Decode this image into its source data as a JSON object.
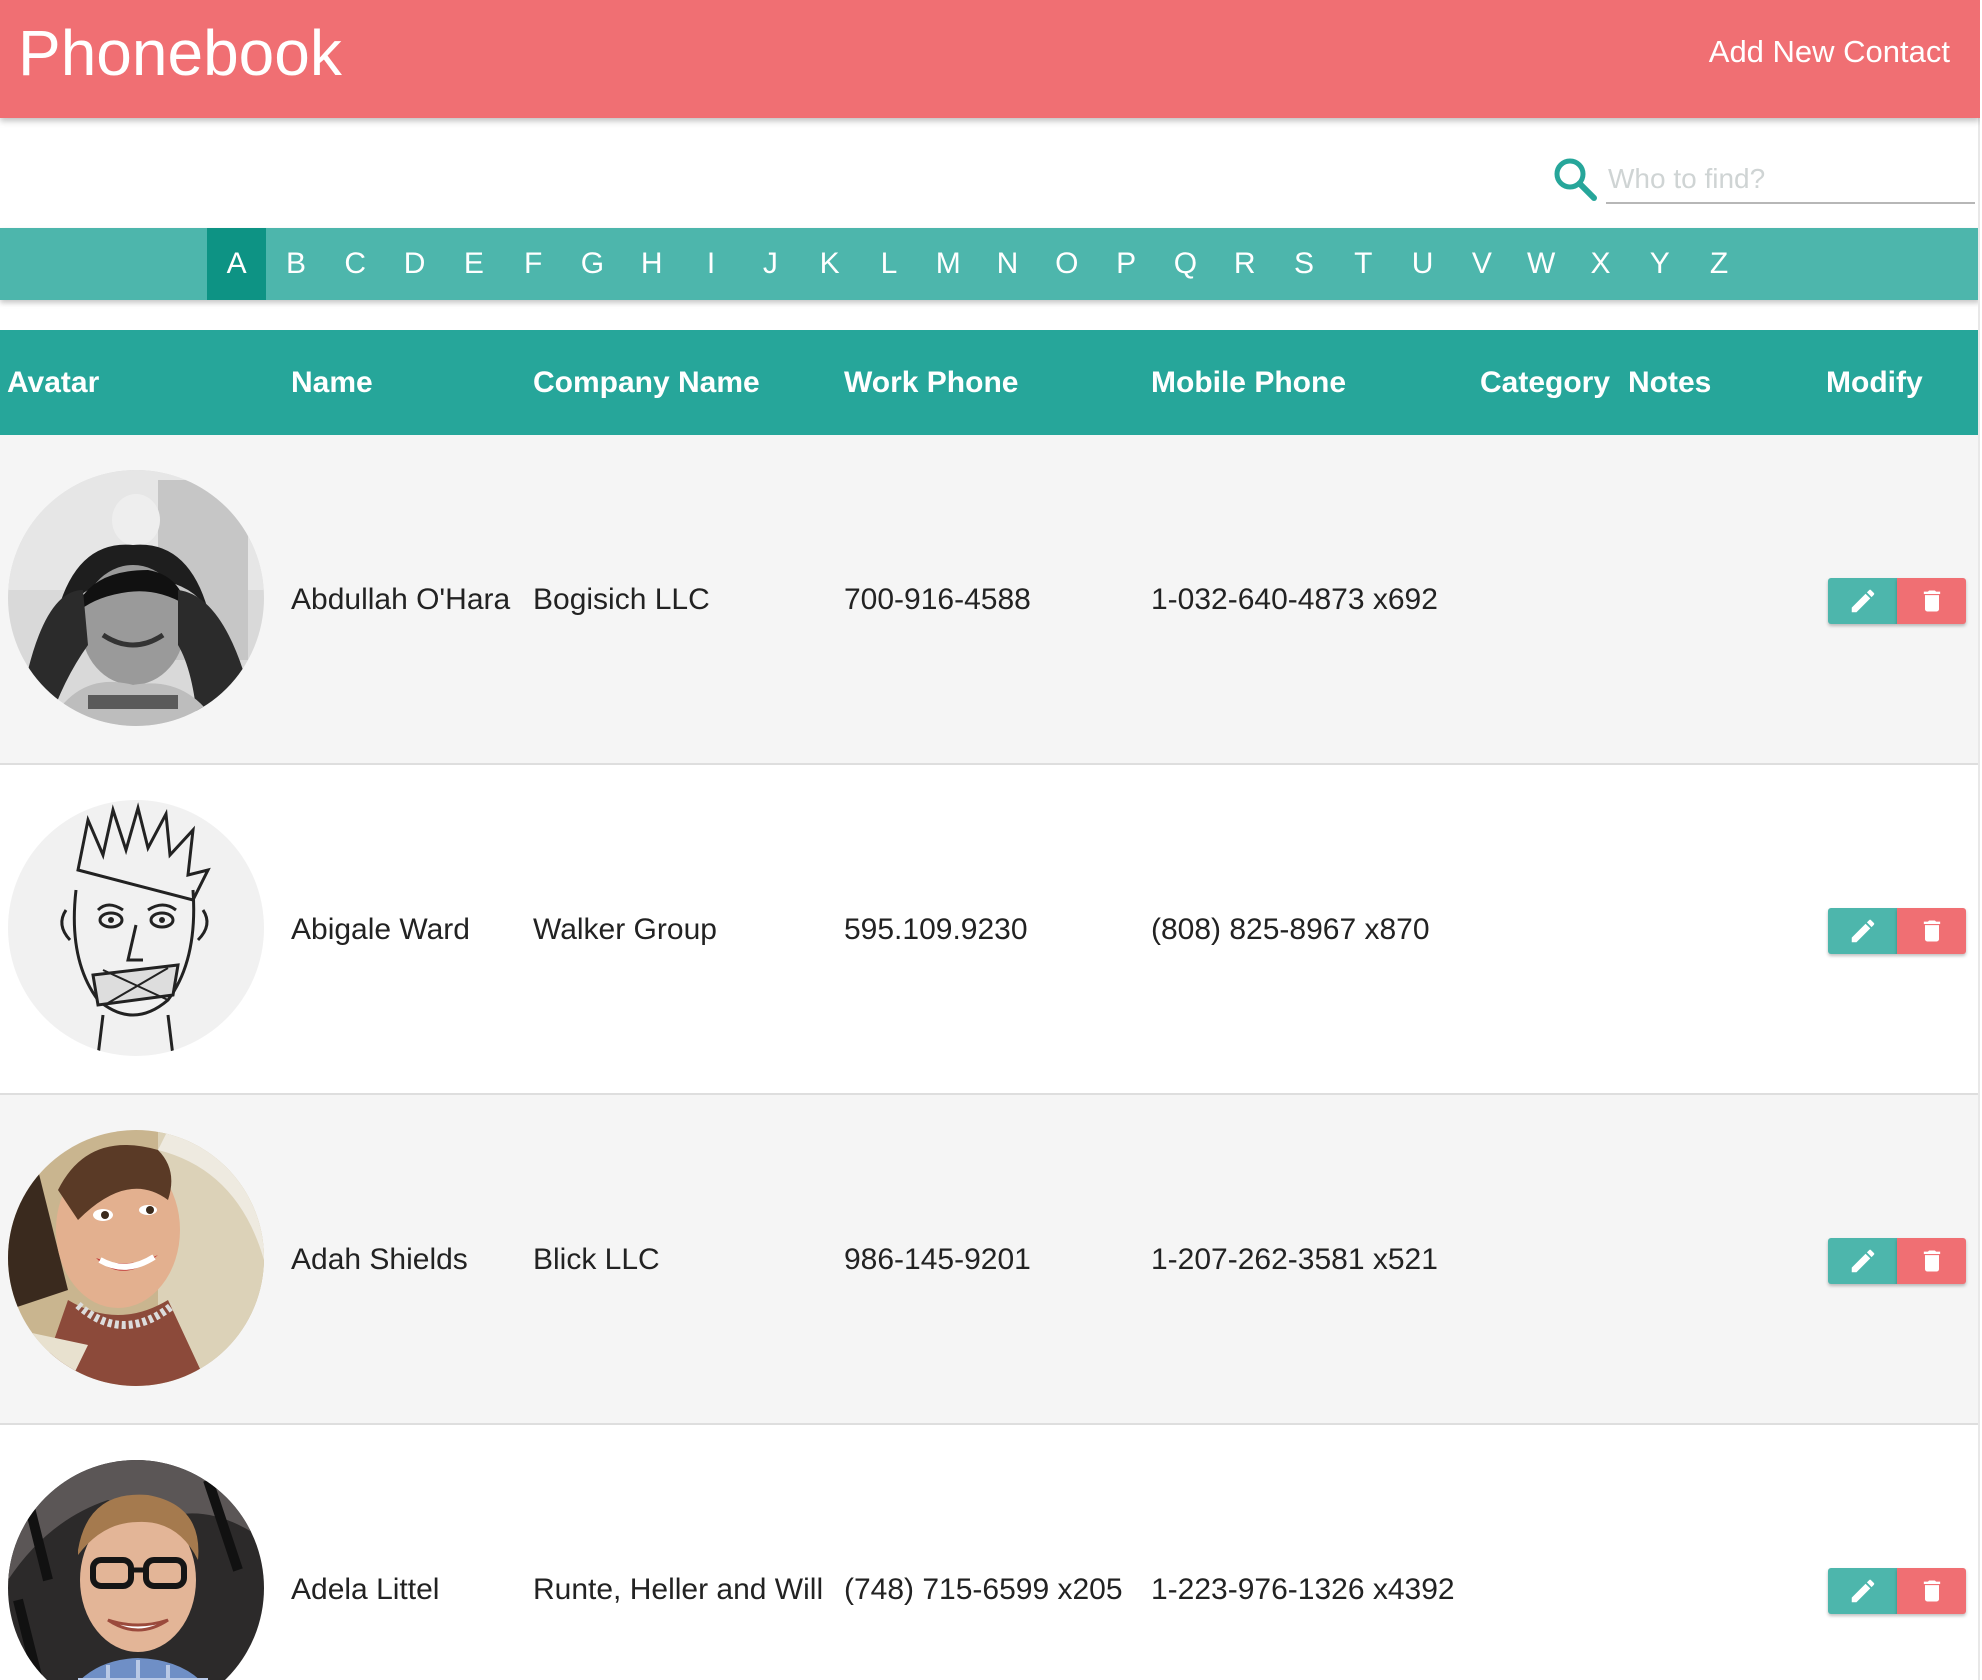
{
  "header": {
    "title": "Phonebook",
    "add_contact": "Add New Contact",
    "color": "#f06f73"
  },
  "search": {
    "placeholder": "Who to find?",
    "value": "",
    "icon": "search-icon"
  },
  "alphabet": {
    "letters": [
      "A",
      "B",
      "C",
      "D",
      "E",
      "F",
      "G",
      "H",
      "I",
      "J",
      "K",
      "L",
      "M",
      "N",
      "O",
      "P",
      "Q",
      "R",
      "S",
      "T",
      "U",
      "V",
      "W",
      "X",
      "Y",
      "Z"
    ],
    "active": "A",
    "color": "#4db6ac",
    "active_color": "#0d9384"
  },
  "table": {
    "columns": {
      "avatar": "Avatar",
      "name": "Name",
      "company": "Company Name",
      "work_phone": "Work Phone",
      "mobile_phone": "Mobile Phone",
      "category": "Category",
      "notes": "Notes",
      "modify": "Modify"
    },
    "header_color": "#26a69a",
    "rows": [
      {
        "name": "Abdullah O'Hara",
        "company": "Bogisich LLC",
        "work_phone": "700-916-4588",
        "mobile_phone": "1-032-640-4873 x692",
        "category": "",
        "notes": "",
        "avatar": "photo-person-with-baby"
      },
      {
        "name": "Abigale Ward",
        "company": "Walker Group",
        "work_phone": "595.109.9230",
        "mobile_phone": "(808) 825-8967 x870",
        "category": "",
        "notes": "",
        "avatar": "sketch-face"
      },
      {
        "name": "Adah Shields",
        "company": "Blick LLC",
        "work_phone": "986-145-9201",
        "mobile_phone": "1-207-262-3581 x521",
        "category": "",
        "notes": "",
        "avatar": "photo-smiling-woman"
      },
      {
        "name": "Adela Littel",
        "company": "Runte, Heller and Will",
        "work_phone": "(748) 715-6599 x205",
        "mobile_phone": "1-223-976-1326 x4392",
        "category": "",
        "notes": "",
        "avatar": "photo-man-glasses"
      }
    ],
    "edit_icon": "pencil-icon",
    "delete_icon": "trash-icon"
  }
}
